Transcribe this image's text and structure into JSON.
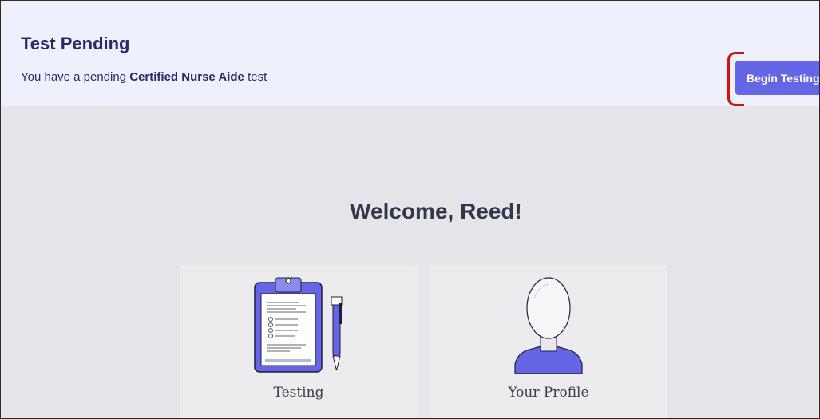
{
  "banner": {
    "title": "Test Pending",
    "message_prefix": "You have a pending ",
    "test_name": "Certified Nurse Aide",
    "message_suffix": " test",
    "begin_button": "Begin Testing"
  },
  "welcome": {
    "heading": "Welcome, Reed!"
  },
  "cards": [
    {
      "label": "Testing",
      "icon": "clipboard-icon"
    },
    {
      "label": "Your Profile",
      "icon": "profile-icon"
    }
  ],
  "colors": {
    "accent": "#6566e6",
    "banner_bg": "#eef0fb",
    "heading": "#27296a",
    "page_bg": "#e4e5e9",
    "highlight": "#d01212"
  }
}
